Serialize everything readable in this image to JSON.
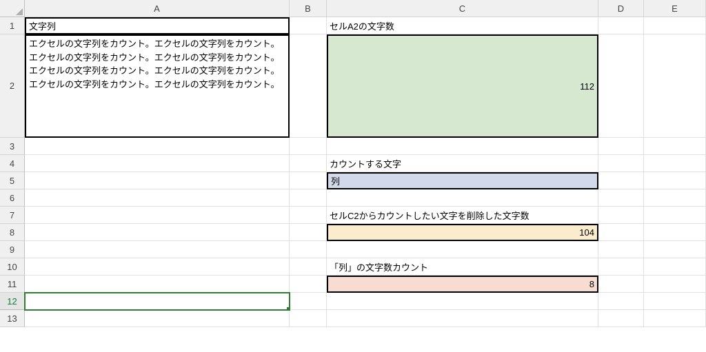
{
  "columns": [
    "A",
    "B",
    "C",
    "D",
    "E"
  ],
  "rows": [
    "1",
    "2",
    "3",
    "4",
    "5",
    "6",
    "7",
    "8",
    "9",
    "10",
    "11",
    "12",
    "13"
  ],
  "cells": {
    "A1": "文字列",
    "A2": "エクセルの文字列をカウント。エクセルの文字列をカウント。エクセルの文字列をカウント。エクセルの文字列をカウント。エクセルの文字列をカウント。エクセルの文字列をカウント。エクセルの文字列をカウント。エクセルの文字列をカウント。",
    "C1": "セルA2の文字数",
    "C2": "112",
    "C4": "カウントする文字",
    "C5": "列",
    "C7": "セルC2からカウントしたい文字を削除した文字数",
    "C8": "104",
    "C10": "「列」の文字数カウント",
    "C11": "8"
  },
  "selected_row": "12",
  "chart_data": {
    "type": "table",
    "title": "Excel character count demo",
    "rows": [
      {
        "label": "セルA2の文字数",
        "value": 112
      },
      {
        "label": "カウントする文字",
        "value": "列"
      },
      {
        "label": "セルC2からカウントしたい文字を削除した文字数",
        "value": 104
      },
      {
        "label": "「列」の文字数カウント",
        "value": 8
      }
    ]
  }
}
